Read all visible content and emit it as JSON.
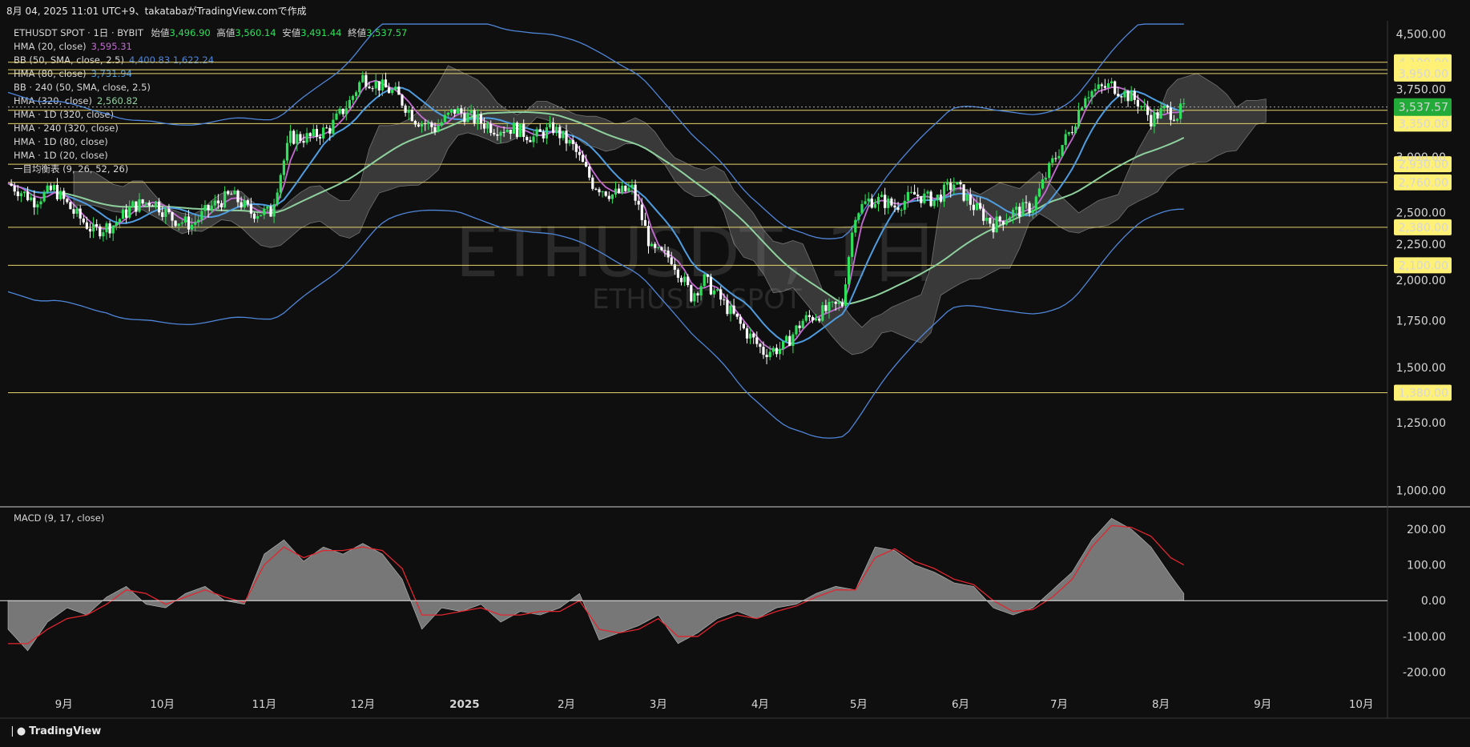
{
  "header": {
    "caption": "8月 04, 2025 11:01 UTC+9、takatabaがTradingView.comで作成"
  },
  "legend": {
    "symbol": "ETHUSDT SPOT · 1日 · BYBIT",
    "open_label": "始値",
    "open": "3,496.90",
    "high_label": "高値",
    "high": "3,560.14",
    "low_label": "安値",
    "low": "3,491.44",
    "close_label": "終値",
    "close": "3,537.57",
    "items": [
      {
        "label": "HMA (20, close)",
        "value": "3,595.31",
        "color": "#c36bd1"
      },
      {
        "label": "BB (50, SMA, close, 2.5)",
        "value": "4,400.83  1,622.24",
        "color": "#4f86d9"
      },
      {
        "label": "HMA (80, close)",
        "value": "3,731.94",
        "color": "#4f9de0"
      },
      {
        "label": "BB · 240 (50, SMA, close, 2.5)",
        "value": "",
        "color": ""
      },
      {
        "label": "HMA (320, close)",
        "value": "2,560.82",
        "color": "#8fd19e"
      },
      {
        "label": "HMA · 1D (320, close)",
        "value": "",
        "color": ""
      },
      {
        "label": "HMA · 240 (320, close)",
        "value": "",
        "color": ""
      },
      {
        "label": "HMA · 1D (80, close)",
        "value": "",
        "color": ""
      },
      {
        "label": "HMA · 1D (20, close)",
        "value": "",
        "color": ""
      },
      {
        "label": "一目均衡表 (9, 26, 52, 26)",
        "value": "",
        "color": ""
      }
    ]
  },
  "watermark": {
    "line1": "ETHUSDT, 1日",
    "line2": "ETHUSDT SPOT"
  },
  "macd": {
    "title": "MACD (9, 17, close)"
  },
  "footer": {
    "brand": "TradingView"
  },
  "colors": {
    "bg": "#0f0f0f",
    "grid_line": "#ffffff",
    "level_line": "#e8d36a",
    "level_label_bg": "#fff176",
    "last_price_bg": "#22ab39",
    "candle_up": "#2ee05a",
    "candle_down": "#ffffff",
    "hma20": "#c36bd1",
    "hma80": "#4f9de0",
    "hma320": "#8fd19e",
    "bb": "#4f86d9",
    "cloud": "#8a8a8a",
    "macd_hist": "#8a8a8a",
    "signal": "#e0262f"
  },
  "chart_data": [
    {
      "type": "candlestick",
      "title": "ETHUSDT SPOT · 1日 · BYBIT",
      "y_scale": "log",
      "ylim": [
        950,
        4700
      ],
      "price_ticks": [
        "4,500.00",
        "3,750.00",
        "3,000.00",
        "2,500.00",
        "2,250.00",
        "2,000.00",
        "1,750.00",
        "1,500.00",
        "1,250.00",
        "1,000.00"
      ],
      "price_tick_values": [
        4500,
        3750,
        3000,
        2500,
        2250,
        2000,
        1750,
        1500,
        1250,
        1000
      ],
      "x_labels": [
        "9月",
        "10月",
        "11月",
        "12月",
        "2025",
        "2月",
        "3月",
        "4月",
        "5月",
        "6月",
        "7月",
        "8月",
        "9月",
        "10月"
      ],
      "x_label_days": [
        17,
        47,
        78,
        108,
        139,
        170,
        198,
        229,
        259,
        290,
        320,
        351,
        382,
        412
      ],
      "levels": [
        {
          "label": "4,100.00",
          "value": 4100
        },
        {
          "label": "4,000.00",
          "value": 4000
        },
        {
          "label": "3,950.00",
          "value": 3950
        },
        {
          "label": "3,500.00",
          "value": 3500
        },
        {
          "label": "3,350.00",
          "value": 3350
        },
        {
          "label": "2,930.00",
          "value": 2930
        },
        {
          "label": "2,760.00",
          "value": 2760
        },
        {
          "label": "2,380.00",
          "value": 2380
        },
        {
          "label": "2,100.00",
          "value": 2100
        },
        {
          "label": "1,380.00",
          "value": 1380
        }
      ],
      "last_price": {
        "label": "3,537.57",
        "value": 3537.57
      },
      "price_path_days": [
        0,
        8,
        14,
        20,
        26,
        32,
        38,
        44,
        50,
        56,
        62,
        68,
        74,
        80,
        86,
        92,
        98,
        104,
        108,
        113,
        118,
        124,
        130,
        136,
        142,
        148,
        154,
        160,
        166,
        172,
        178,
        184,
        190,
        196,
        202,
        208,
        212,
        218,
        224,
        230,
        236,
        242,
        248,
        254,
        258,
        262,
        266,
        270,
        276,
        282,
        288,
        294,
        300,
        306,
        312,
        318,
        324,
        328,
        332,
        336,
        340,
        344,
        348,
        352,
        356,
        358
      ],
      "price_path_close": [
        2750,
        2600,
        2700,
        2500,
        2350,
        2400,
        2550,
        2600,
        2450,
        2400,
        2550,
        2650,
        2500,
        2500,
        3200,
        3200,
        3300,
        3600,
        3900,
        3800,
        3700,
        3400,
        3300,
        3500,
        3400,
        3300,
        3300,
        3200,
        3300,
        3100,
        2750,
        2650,
        2700,
        2200,
        2150,
        1900,
        2000,
        1850,
        1700,
        1580,
        1600,
        1750,
        1800,
        1850,
        2500,
        2600,
        2600,
        2550,
        2650,
        2600,
        2750,
        2550,
        2400,
        2500,
        2550,
        2950,
        3300,
        3700,
        3750,
        3800,
        3700,
        3600,
        3400,
        3500,
        3450,
        3537
      ]
    },
    {
      "type": "histogram",
      "title": "MACD (9, 17, close)",
      "ylim": [
        -250,
        260
      ],
      "ticks": [
        "200.00",
        "100.00",
        "0.00",
        "-100.00",
        "-200.00"
      ],
      "tick_values": [
        200,
        100,
        0,
        -100,
        -200
      ],
      "macd_days": [
        0,
        6,
        12,
        18,
        24,
        30,
        36,
        42,
        48,
        54,
        60,
        66,
        72,
        78,
        84,
        90,
        96,
        102,
        108,
        114,
        120,
        126,
        132,
        138,
        144,
        150,
        156,
        162,
        168,
        174,
        180,
        186,
        192,
        198,
        204,
        210,
        216,
        222,
        228,
        234,
        240,
        246,
        252,
        258,
        264,
        270,
        276,
        282,
        288,
        294,
        300,
        306,
        312,
        318,
        324,
        330,
        336,
        342,
        348,
        354,
        358
      ],
      "macd_values": [
        -80,
        -140,
        -60,
        -20,
        -40,
        10,
        40,
        -10,
        -20,
        20,
        40,
        0,
        -10,
        130,
        170,
        110,
        150,
        130,
        160,
        130,
        60,
        -80,
        -20,
        -30,
        -10,
        -60,
        -30,
        -40,
        -20,
        20,
        -110,
        -90,
        -70,
        -40,
        -120,
        -90,
        -50,
        -30,
        -50,
        -20,
        -10,
        20,
        40,
        30,
        150,
        140,
        100,
        80,
        50,
        40,
        -20,
        -40,
        -20,
        30,
        80,
        170,
        230,
        200,
        150,
        70,
        20
      ],
      "signal_values": [
        -120,
        -120,
        -80,
        -50,
        -40,
        -10,
        30,
        20,
        -10,
        10,
        30,
        10,
        -5,
        100,
        150,
        120,
        140,
        140,
        150,
        140,
        90,
        -40,
        -40,
        -30,
        -20,
        -40,
        -40,
        -30,
        -30,
        0,
        -80,
        -90,
        -80,
        -50,
        -100,
        -100,
        -60,
        -40,
        -50,
        -30,
        -15,
        10,
        30,
        30,
        120,
        145,
        110,
        90,
        60,
        45,
        0,
        -30,
        -25,
        10,
        60,
        150,
        210,
        205,
        180,
        120,
        100
      ]
    }
  ]
}
